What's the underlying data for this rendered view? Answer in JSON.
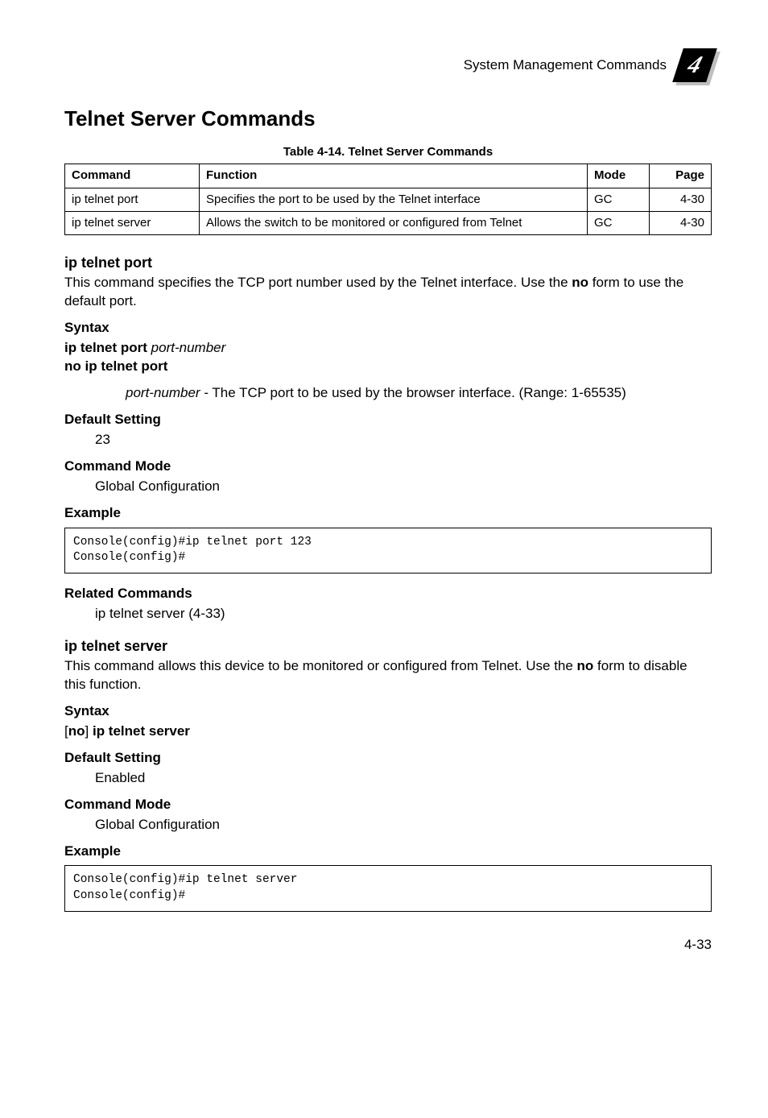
{
  "header": {
    "title": "System Management Commands",
    "chapter": "4"
  },
  "section_title": "Telnet Server Commands",
  "table": {
    "caption": "Table 4-14.  Telnet Server Commands",
    "headers": [
      "Command",
      "Function",
      "Mode",
      "Page"
    ],
    "rows": [
      {
        "cmd": "ip telnet port",
        "func": "Specifies the port to be used by the Telnet interface",
        "mode": "GC",
        "page": "4-30"
      },
      {
        "cmd": "ip telnet server",
        "func": "Allows the switch to be monitored or configured from Telnet",
        "mode": "GC",
        "page": "4-30"
      }
    ]
  },
  "ip_telnet_port": {
    "heading": "ip telnet port",
    "desc_pre": "This command specifies the TCP port number used by the Telnet interface. Use the ",
    "desc_bold": "no",
    "desc_post": " form to use the default port.",
    "syntax_label": "Syntax",
    "syntax_line1_b1": "ip telnet port ",
    "syntax_line1_i": "port-number",
    "syntax_line2": "no ip telnet port",
    "param_i": "port-number",
    "param_rest": " - The TCP port to be used by the browser interface. (Range: 1-65535)",
    "default_label": "Default Setting",
    "default_value": "23",
    "mode_label": "Command Mode",
    "mode_value": "Global Configuration",
    "example_label": "Example",
    "example_code": "Console(config)#ip telnet port 123\nConsole(config)#",
    "related_label": "Related Commands",
    "related_value": "ip telnet server (4-33)"
  },
  "ip_telnet_server": {
    "heading": "ip telnet server",
    "desc_pre": "This command allows this device to be monitored or configured from Telnet. Use the ",
    "desc_bold": "no",
    "desc_post": " form to disable this function.",
    "syntax_label": "Syntax",
    "syntax_br_open": "[",
    "syntax_no": "no",
    "syntax_br_close": "] ",
    "syntax_cmd": "ip telnet server",
    "default_label": "Default Setting",
    "default_value": "Enabled",
    "mode_label": "Command Mode",
    "mode_value": "Global Configuration",
    "example_label": "Example",
    "example_code": "Console(config)#ip telnet server\nConsole(config)#"
  },
  "page_number": "4-33"
}
